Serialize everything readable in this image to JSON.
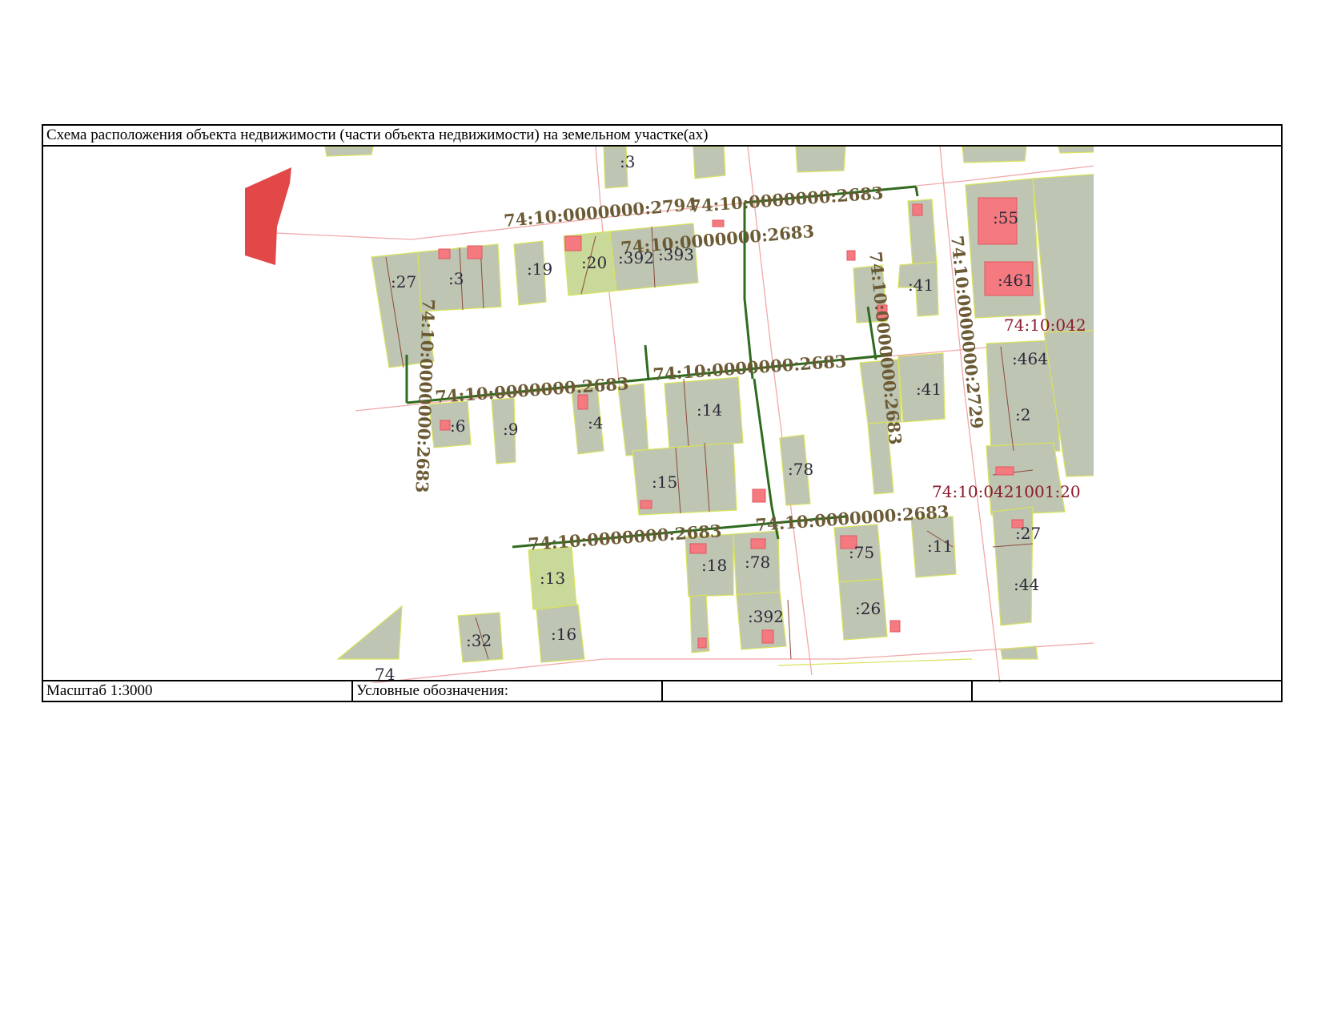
{
  "title": "Схема расположения объекта недвижимости (части объекта недвижимости) на земельном участке(ах)",
  "footer": {
    "scale": "Масштаб 1:3000",
    "legend": "Условные обозначения:",
    "cell3": "",
    "cell4": ""
  },
  "map": {
    "parcel_labels": {
      "p3_top": ":3",
      "p27_left": ":27",
      "p3_left": ":3",
      "p19": ":19",
      "p20": ":20",
      "p392": ":392",
      "p393": ":393",
      "p41_top": ":41",
      "p55": ":55",
      "p461": ":461",
      "p464": ":464",
      "p41_mid": ":41",
      "p2": ":2",
      "p6": ":6",
      "p9": ":9",
      "p4": ":4",
      "p14": ":14",
      "p15": ":15",
      "p78_mid": ":78",
      "p27_right": ":27",
      "p44": ":44",
      "p13": ":13",
      "p18": ":18",
      "p78_low": ":78",
      "p75": ":75",
      "p11": ":11",
      "p26": ":26",
      "p392_low": ":392",
      "p16": ":16",
      "p32": ":32",
      "p74": "74"
    },
    "cadastral_labels": {
      "c2794": "74:10:0000000:2794",
      "c2683_a": "74:10:0000000:2683",
      "c2683_b": "74:10:0000000:2683",
      "c2683_c": "74:10:0000000:2683",
      "c2683_d": "74:10:0000000:2683",
      "c2683_e": "74:10:0000000:2683",
      "c2683_f": "74:10:0000000:2683",
      "c2683_g": "74:10:0000000:2683",
      "c2683_h": "74:10:0000000:2683",
      "c2729": "74:10:0000000:2729"
    },
    "block_labels": {
      "b042_top": "74:10:042",
      "b0421001": "74:10:0421001:20"
    },
    "colors": {
      "parcel": "#bfc5b3",
      "parcel_light": "#c9d99a",
      "building": "#f47a80",
      "road_line": "#f2a8a8",
      "zone_line": "#2e6b1f",
      "cadastral_text": "#6b5a34",
      "block_text": "#8b1a2b",
      "highlight": "#e34848"
    }
  }
}
